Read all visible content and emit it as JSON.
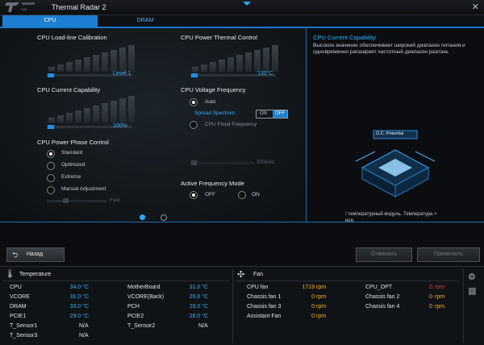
{
  "window": {
    "title": "Thermal Radar 2",
    "close_glyph": "✕",
    "logo_icon": "tuf-logo"
  },
  "tabs": [
    {
      "label": "CPU",
      "active": true
    },
    {
      "label": "DRAM",
      "active": false
    }
  ],
  "cpu": {
    "llc": {
      "label": "CPU Load-line Calibration",
      "value": "Level 1"
    },
    "current_capability": {
      "label": "CPU Current Capability",
      "value": "100%"
    },
    "phase_control": {
      "label": "CPU Power Phase Control",
      "options": [
        "Standard",
        "Optimized",
        "Extreme",
        "Manual Adjustment"
      ],
      "selected": "Standard",
      "slider_label": "Fast"
    },
    "thermal_control": {
      "label": "CPU Power Thermal Control",
      "value": "130°C"
    },
    "voltage_frequency": {
      "label": "CPU Voltage Frequency",
      "auto_label": "Auto",
      "spread_spectrum_label": "Spread Spectrum",
      "toggle_on": "ON",
      "toggle_off": "OFF",
      "fixed_label": "CPU Fixed Frequency",
      "fixed_value": "300kHz"
    },
    "active_frequency": {
      "label": "Active Frequency Mode",
      "options": [
        "OFF",
        "ON"
      ],
      "selected": "OFF"
    },
    "pager": {
      "pages": 2,
      "current": 1
    }
  },
  "info": {
    "title": "CPU Current Capability",
    "body": "Высокое значение обеспечивает широкий диапазон питания и одновременно расширяет частотный диапазон разгона.",
    "badge": "O.C. Potential",
    "footer_line1": "! температурный модуль. Температура >",
    "footer_line2": "ися."
  },
  "buttons": {
    "back": "Назад",
    "apply_left": "Отменить",
    "apply_right": "Применить"
  },
  "temperature": {
    "title": "Temperature",
    "left": [
      {
        "name": "CPU",
        "value": "34.0 °C"
      },
      {
        "name": "VCORE",
        "value": "31.0 °C"
      },
      {
        "name": "DRAM",
        "value": "33.0 °C"
      },
      {
        "name": "PCIE1",
        "value": "29.0 °C"
      },
      {
        "name": "T_Sensor1",
        "value": "N/A"
      },
      {
        "name": "T_Sensor3",
        "value": "N/A"
      }
    ],
    "right": [
      {
        "name": "MotherBoard",
        "value": "31.0 °C"
      },
      {
        "name": "VCORE(Back)",
        "value": "29.0 °C"
      },
      {
        "name": "PCH",
        "value": "29.0 °C"
      },
      {
        "name": "PCIE2",
        "value": "28.0 °C"
      },
      {
        "name": "T_Sensor2",
        "value": "N/A"
      }
    ]
  },
  "fan": {
    "title": "Fan",
    "left": [
      {
        "name": "CPU fan",
        "value": "1719",
        "unit": "rpm"
      },
      {
        "name": "Chassis fan 1",
        "value": "0",
        "unit": "rpm"
      },
      {
        "name": "Chassis fan 3",
        "value": "0",
        "unit": "rpm"
      },
      {
        "name": "Assistant Fan",
        "value": "0",
        "unit": "rpm"
      }
    ],
    "right": [
      {
        "name": "CPU_OPT",
        "value": "0",
        "unit": "rpm"
      },
      {
        "name": "Chassis fan 2",
        "value": "0",
        "unit": "rpm"
      },
      {
        "name": "Chassis fan 4",
        "value": "0",
        "unit": "rpm"
      }
    ]
  },
  "colors": {
    "accent": "#1d7fd1",
    "value_blue": "#33b3ff",
    "rpm_orange": "#ffb020",
    "alert_red": "#e0342f"
  }
}
